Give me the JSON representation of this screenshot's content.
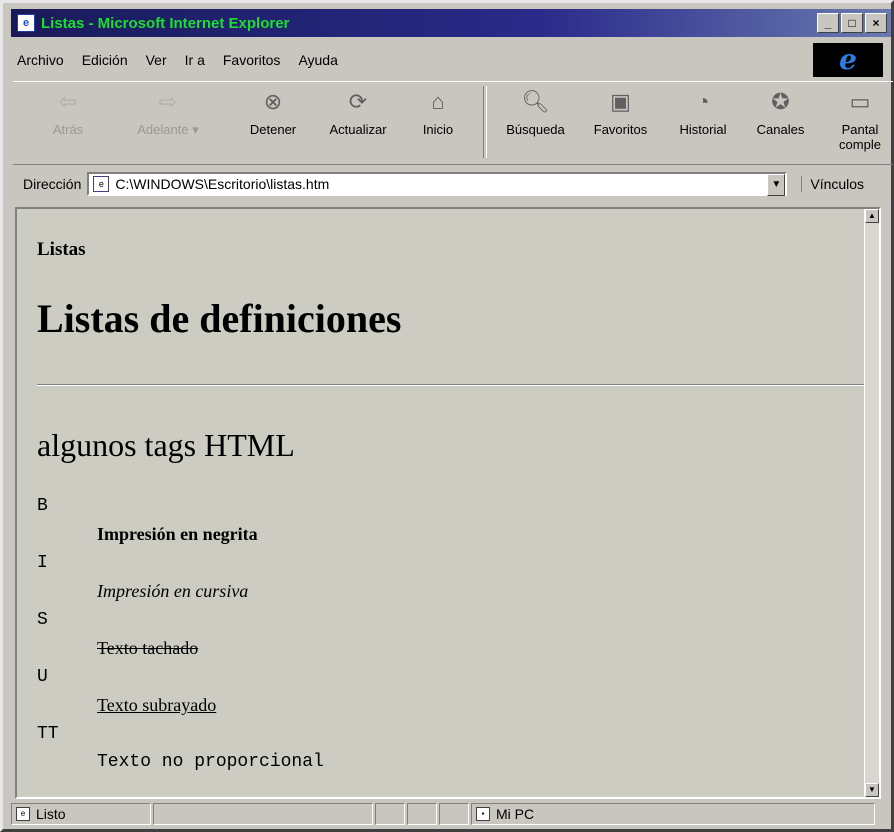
{
  "window": {
    "title": "Listas - Microsoft Internet Explorer",
    "buttons": [
      "_",
      "□",
      "×"
    ]
  },
  "menu": [
    "Archivo",
    "Edición",
    "Ver",
    "Ir a",
    "Favoritos",
    "Ayuda"
  ],
  "toolbar": {
    "back": "Atrás",
    "forward": "Adelante",
    "stop": "Detener",
    "refresh": "Actualizar",
    "home": "Inicio",
    "search": "Búsqueda",
    "favorites": "Favoritos",
    "history": "Historial",
    "channels": "Canales",
    "fullscreen_line1": "Pantal",
    "fullscreen_line2": "comple"
  },
  "address": {
    "label": "Dirección",
    "value": "C:\\WINDOWS\\Escritorio\\listas.htm",
    "links_label": "Vínculos"
  },
  "page": {
    "h4": "Listas",
    "h1": "Listas de definiciones",
    "h2": "algunos tags HTML",
    "definitions": [
      {
        "term": "B",
        "desc": "Impresión en negrita"
      },
      {
        "term": "I",
        "desc": "Impresión en cursiva"
      },
      {
        "term": "S",
        "desc": "Texto tachado"
      },
      {
        "term": "U",
        "desc": "Texto subrayado"
      },
      {
        "term": "TT",
        "desc": "Texto no proporcional"
      }
    ]
  },
  "status": {
    "text": "Listo",
    "zone": "Mi PC"
  }
}
